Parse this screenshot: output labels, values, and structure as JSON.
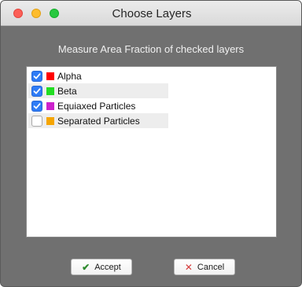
{
  "window": {
    "title": "Choose Layers"
  },
  "dialog": {
    "subtitle": "Measure Area Fraction of checked layers"
  },
  "layers": [
    {
      "label": "Alpha",
      "checked": true,
      "color": "#ff0000"
    },
    {
      "label": "Beta",
      "checked": true,
      "color": "#22dd22"
    },
    {
      "label": "Equiaxed Particles",
      "checked": true,
      "color": "#cc22cc"
    },
    {
      "label": "Separated Particles",
      "checked": false,
      "color": "#f5a500"
    }
  ],
  "buttons": {
    "accept_label": "Accept",
    "accept_icon": "checkmark-icon",
    "cancel_label": "Cancel",
    "cancel_icon": "x-icon"
  },
  "colors": {
    "window_background": "#707070",
    "checkbox_accent": "#2f7cf6"
  }
}
